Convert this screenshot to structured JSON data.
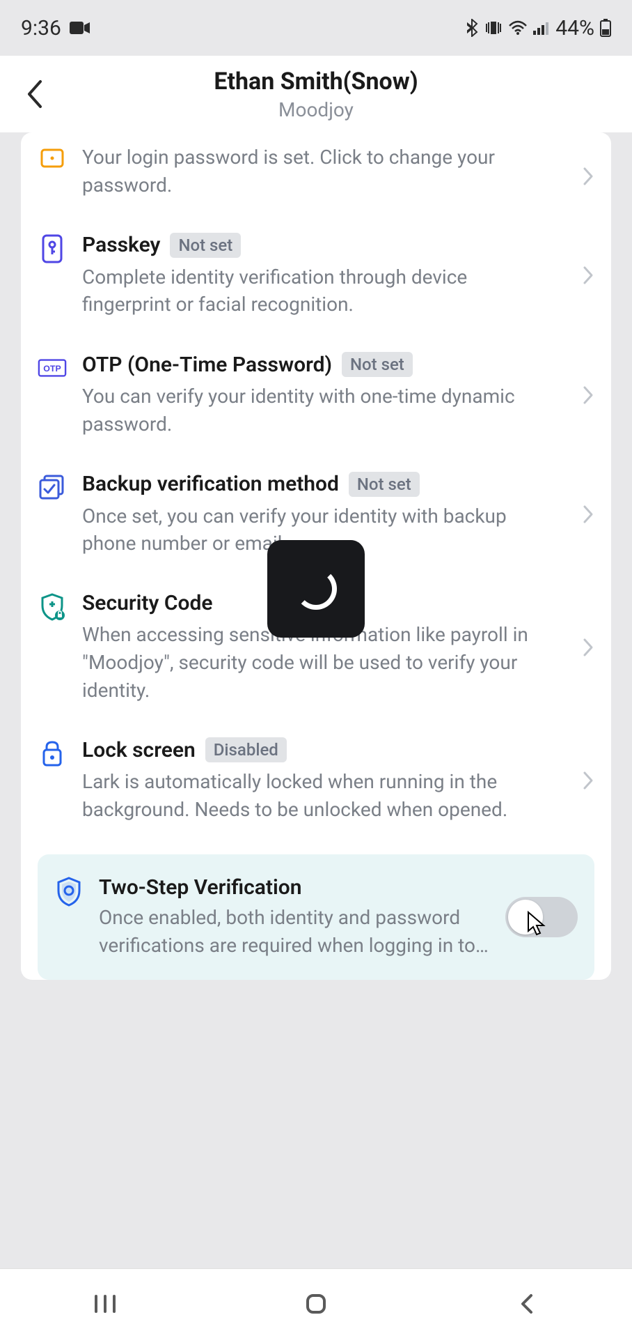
{
  "status_bar": {
    "time": "9:36",
    "battery_percent": "44%"
  },
  "header": {
    "title": "Ethan Smith(Snow)",
    "subtitle": "Moodjoy"
  },
  "items": {
    "login_password": {
      "desc": "Your login password is set. Click to change your password."
    },
    "passkey": {
      "title": "Passkey",
      "badge": "Not set",
      "desc": "Complete identity verification through device fingerprint or facial recognition."
    },
    "otp": {
      "title": "OTP (One-Time Password)",
      "badge": "Not set",
      "desc": "You can verify your identity with one-time dynamic password."
    },
    "backup": {
      "title": "Backup verification method",
      "badge": "Not set",
      "desc": "Once set, you can verify your identity with backup phone number or email."
    },
    "security_code": {
      "title": "Security Code",
      "desc": "When accessing sensitive information like payroll in \"Moodjoy\", security code will be used to verify your identity."
    },
    "lock_screen": {
      "title": "Lock screen",
      "badge": "Disabled",
      "desc": "Lark is automatically locked when running in the background. Needs to be unlocked when opened."
    },
    "two_step": {
      "title": "Two-Step Verification",
      "desc": "Once enabled, both identity and password verifications are required when logging in to…",
      "enabled": false
    }
  }
}
